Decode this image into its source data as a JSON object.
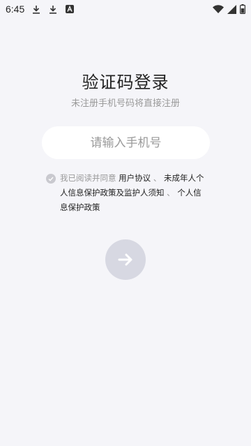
{
  "status_bar": {
    "time": "6:45",
    "icons": [
      "download-icon",
      "download-icon",
      "a-notification-icon"
    ],
    "right_icons": [
      "wifi-icon",
      "signal-icon",
      "battery-icon"
    ]
  },
  "login": {
    "title": "验证码登录",
    "subtitle": "未注册手机号码将直接注册",
    "phone_placeholder": "请输入手机号",
    "phone_value": ""
  },
  "agreement": {
    "checked": true,
    "prefix": "我已阅读并同意",
    "user_agreement": "用户协议",
    "sep1": "、",
    "minor_policy": "未成年人个人信息保护政策及监护人须知",
    "sep2": "、",
    "privacy_policy": "个人信息保护政策"
  },
  "next_button": {
    "icon": "arrow-right-icon",
    "enabled": false
  },
  "colors": {
    "background": "#f5f5f9",
    "button_disabled": "#d7d8e2",
    "muted_text": "#9a9a9a"
  }
}
